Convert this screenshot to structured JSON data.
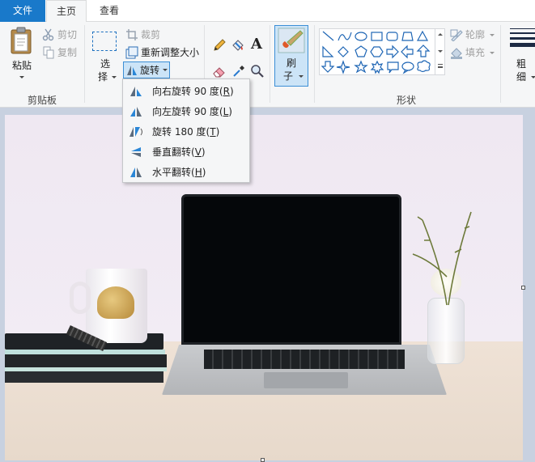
{
  "tabs": {
    "file": "文件",
    "home": "主页",
    "view": "查看"
  },
  "clipboard": {
    "paste_line1": "粘贴",
    "cut": "剪切",
    "copy": "复制",
    "group_label": "剪贴板"
  },
  "image": {
    "select_line1": "选",
    "select_line2": "择",
    "crop": "裁剪",
    "resize": "重新调整大小",
    "rotate": "旋转"
  },
  "brushes": {
    "line1": "刷",
    "line2": "子"
  },
  "shapes": {
    "outline": "轮廓",
    "fill": "填充",
    "group_label": "形状"
  },
  "size": {
    "line1": "粗",
    "line2": "细"
  },
  "rotate_menu": {
    "items": [
      {
        "label": "向右旋转 90 度",
        "key": "R"
      },
      {
        "label": "向左旋转 90 度",
        "key": "L"
      },
      {
        "label": "旋转 180 度",
        "key": "T"
      },
      {
        "label": "垂直翻转",
        "key": "V"
      },
      {
        "label": "水平翻转",
        "key": "H"
      }
    ]
  },
  "colors": {
    "accent": "#1979ca",
    "ribbon_bg": "#f5f6f7",
    "canvas_bg": "#c8d1e0",
    "selected_bg": "#cce4f7"
  }
}
